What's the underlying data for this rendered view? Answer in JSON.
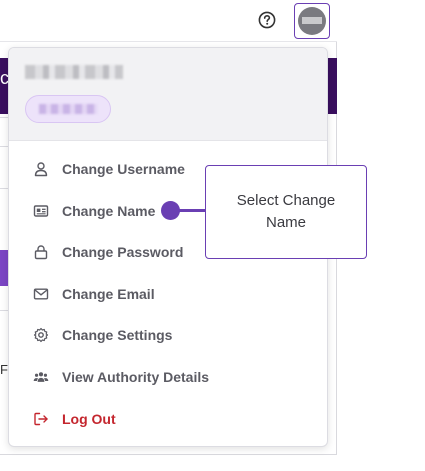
{
  "header": {
    "help_icon": "question-circle-icon",
    "avatar_icon": "user-avatar"
  },
  "background": {
    "edge_glyph": "c",
    "edge_letter": "F"
  },
  "dropdown": {
    "user_name_redacted": "",
    "user_role_redacted": "",
    "items": [
      {
        "label": "Change Username",
        "icon": "user-icon"
      },
      {
        "label": "Change Name",
        "icon": "id-card-icon"
      },
      {
        "label": "Change Password",
        "icon": "lock-icon"
      },
      {
        "label": "Change Email",
        "icon": "envelope-icon"
      },
      {
        "label": "Change Settings",
        "icon": "gear-icon"
      },
      {
        "label": "View Authority Details",
        "icon": "users-group-icon"
      },
      {
        "label": "Log Out",
        "icon": "logout-icon"
      }
    ]
  },
  "callout": {
    "text": "Select Change Name"
  },
  "colors": {
    "accent": "#6a3fb3",
    "nav_dark": "#3a0f5f",
    "logout_red": "#c4262e",
    "menu_text": "#5b5b63",
    "header_bg": "#f2f2f4"
  }
}
